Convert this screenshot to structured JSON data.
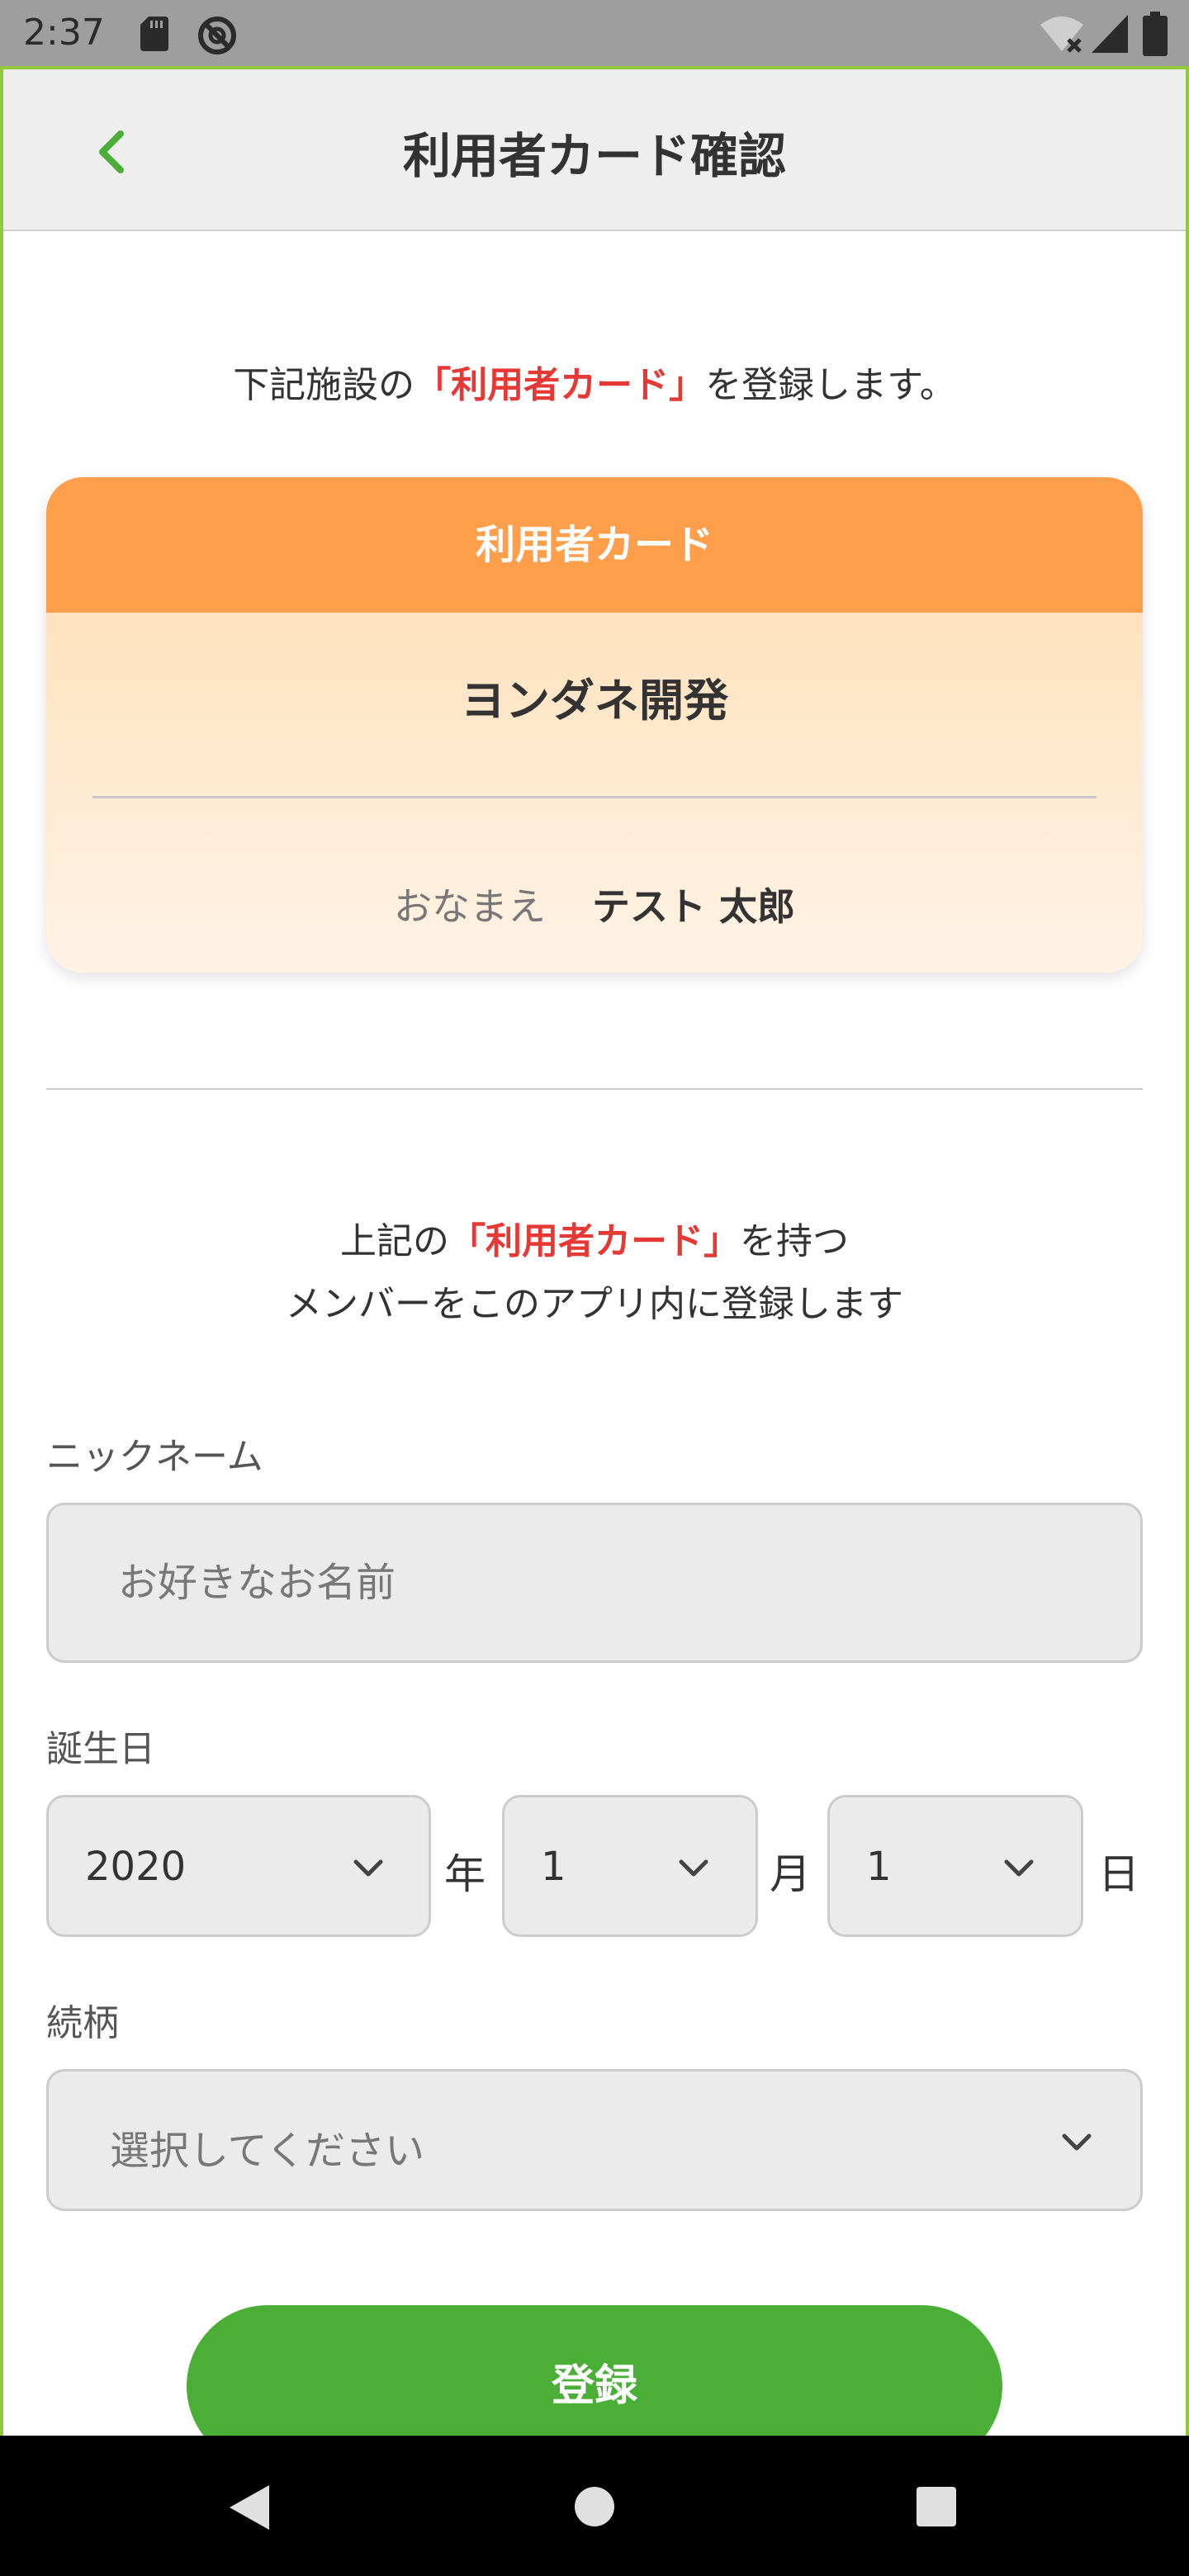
{
  "status_bar": {
    "time": "2:37",
    "icons": [
      "sd-card-icon",
      "no-entry-icon",
      "wifi-off-icon",
      "signal-icon",
      "battery-icon"
    ]
  },
  "header": {
    "title": "利用者カード確認",
    "back_icon": "chevron-left-icon"
  },
  "intro": {
    "before": "下記施設の",
    "highlight": "「利用者カード」",
    "after": "を登録します。"
  },
  "card": {
    "header": "利用者カード",
    "facility_name": "ヨンダネ開発",
    "name_label": "おなまえ",
    "name_value": "テスト 太郎"
  },
  "description": {
    "line1_before": "上記の",
    "line1_highlight": "「利用者カード」",
    "line1_after": "を持つ",
    "line2": "メンバーをこのアプリ内に登録します"
  },
  "form": {
    "nickname_label": "ニックネーム",
    "nickname_placeholder": "お好きなお名前",
    "birthday_label": "誕生日",
    "year_value": "2020",
    "year_unit": "年",
    "month_value": "1",
    "month_unit": "月",
    "day_value": "1",
    "day_unit": "日",
    "relation_label": "続柄",
    "relation_placeholder": "選択してください"
  },
  "register_button": "登録",
  "colors": {
    "accent_green": "#4aae37",
    "card_orange": "#ff9e4b",
    "highlight_red": "#e53935"
  }
}
